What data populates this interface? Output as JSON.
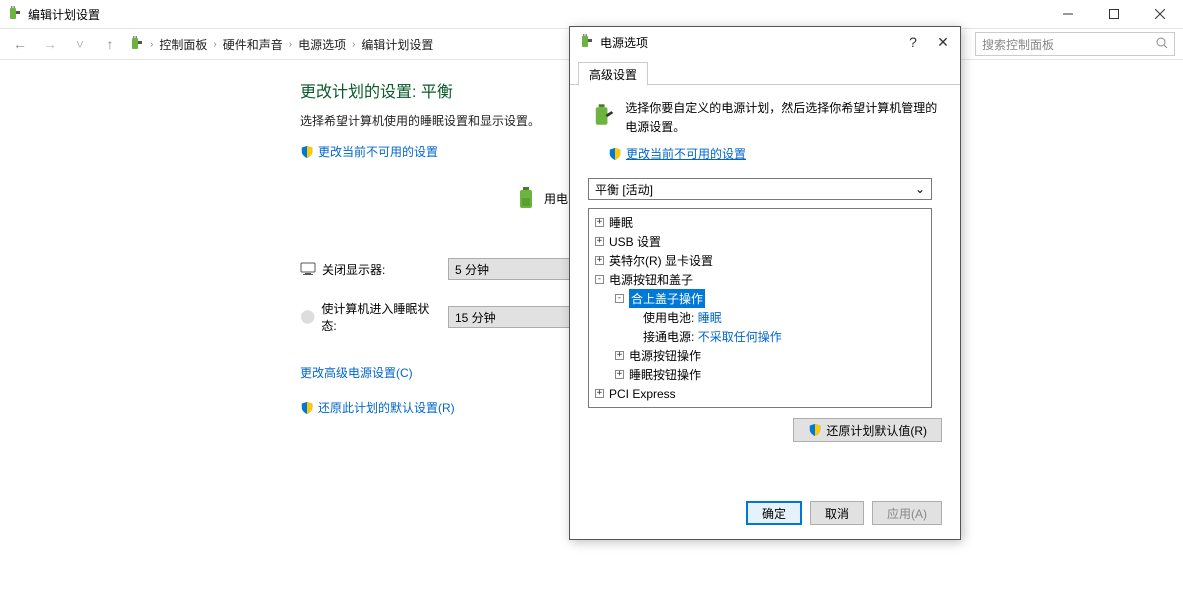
{
  "window": {
    "title": "编辑计划设置",
    "search_placeholder": "搜索控制面板"
  },
  "breadcrumb": {
    "b0": "控制面板",
    "b1": "硬件和声音",
    "b2": "电源选项",
    "b3": "编辑计划设置"
  },
  "page": {
    "heading": "更改计划的设置: 平衡",
    "desc": "选择希望计算机使用的睡眠设置和显示设置。",
    "change_unavailable": "更改当前不可用的设置",
    "on_battery": "用电",
    "turn_off_display": "关闭显示器:",
    "turn_off_value": "5 分钟",
    "sleep_label": "使计算机进入睡眠状态:",
    "sleep_value": "15 分钟",
    "advanced": "更改高级电源设置(C)",
    "restore_defaults": "还原此计划的默认设置(R)"
  },
  "dialog": {
    "title": "电源选项",
    "tab": "高级设置",
    "intro": "选择你要自定义的电源计划，然后选择你希望计算机管理的电源设置。",
    "change_unavailable": "更改当前不可用的设置",
    "plan": "平衡 [活动]",
    "tree": {
      "sleep": "睡眠",
      "usb": "USB 设置",
      "intel": "英特尔(R) 显卡设置",
      "power_buttons": "电源按钮和盖子",
      "lid_close": "合上盖子操作",
      "on_battery_label": "使用电池:",
      "on_battery_value": "睡眠",
      "plugged_label": "接通电源:",
      "plugged_value": "不采取任何操作",
      "power_button_action": "电源按钮操作",
      "sleep_button_action": "睡眠按钮操作",
      "pci": "PCI Express"
    },
    "restore_plan_defaults": "还原计划默认值(R)",
    "ok": "确定",
    "cancel": "取消",
    "apply": "应用(A)"
  }
}
